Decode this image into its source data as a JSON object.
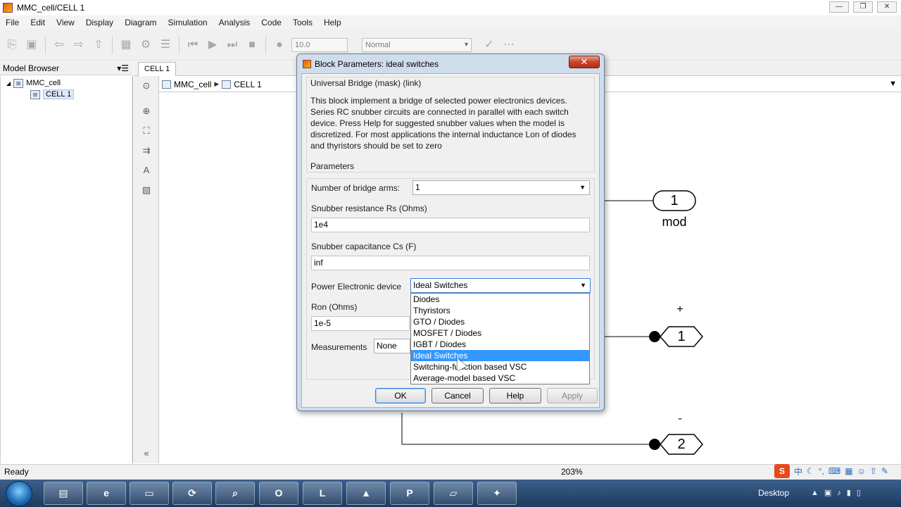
{
  "window": {
    "title": "MMC_cell/CELL 1",
    "controls": [
      "—",
      "❐",
      "✕"
    ]
  },
  "menu": [
    "File",
    "Edit",
    "View",
    "Display",
    "Diagram",
    "Simulation",
    "Analysis",
    "Code",
    "Tools",
    "Help"
  ],
  "toolbar": {
    "stop_time": "10.0",
    "sim_mode": "Normal"
  },
  "model_browser": {
    "title": "Model Browser",
    "root": "MMC_cell",
    "child": "CELL 1"
  },
  "tab": {
    "label": "CELL 1"
  },
  "breadcrumb": {
    "root": "MMC_cell",
    "child": "CELL 1"
  },
  "canvas": {
    "port_in_mod": {
      "number": "1",
      "label": "mod"
    },
    "port_plus": {
      "number": "1",
      "label": "+"
    },
    "port_minus": {
      "number": "2",
      "label": "-"
    }
  },
  "status": {
    "left": "Ready",
    "zoom": "203%"
  },
  "dialog": {
    "title": "Block Parameters: ideal switches",
    "close_glyph": "✕",
    "block_type": "Universal Bridge (mask) (link)",
    "description": "This block implement a bridge of selected power electronics devices. Series RC snubber circuits are connected in parallel with each switch device.  Press Help for suggested snubber values when the model is discretized. For most applications the internal inductance Lon of diodes and thyristors should be set to zero",
    "parameters_label": "Parameters",
    "arms_label": "Number of bridge arms:",
    "arms_value": "1",
    "rs_label": "Snubber resistance Rs (Ohms)",
    "rs_value": "1e4",
    "cs_label": "Snubber capacitance Cs (F)",
    "cs_value": "inf",
    "device_label": "Power Electronic device",
    "device_value": "Ideal Switches",
    "ron_label": "Ron (Ohms)",
    "ron_value": "1e-5",
    "meas_label": "Measurements",
    "meas_value": "None",
    "device_options": [
      "Diodes",
      "Thyristors",
      "GTO / Diodes",
      "MOSFET / Diodes",
      "IGBT / Diodes",
      "Ideal Switches",
      "Switching-function based VSC",
      "Average-model based VSC"
    ],
    "selected_option_index": 5,
    "buttons": {
      "ok": "OK",
      "cancel": "Cancel",
      "help": "Help",
      "apply": "Apply"
    }
  },
  "taskbar": {
    "desktop_label": "Desktop"
  },
  "ime": {
    "logo": "S",
    "mode": "中"
  }
}
